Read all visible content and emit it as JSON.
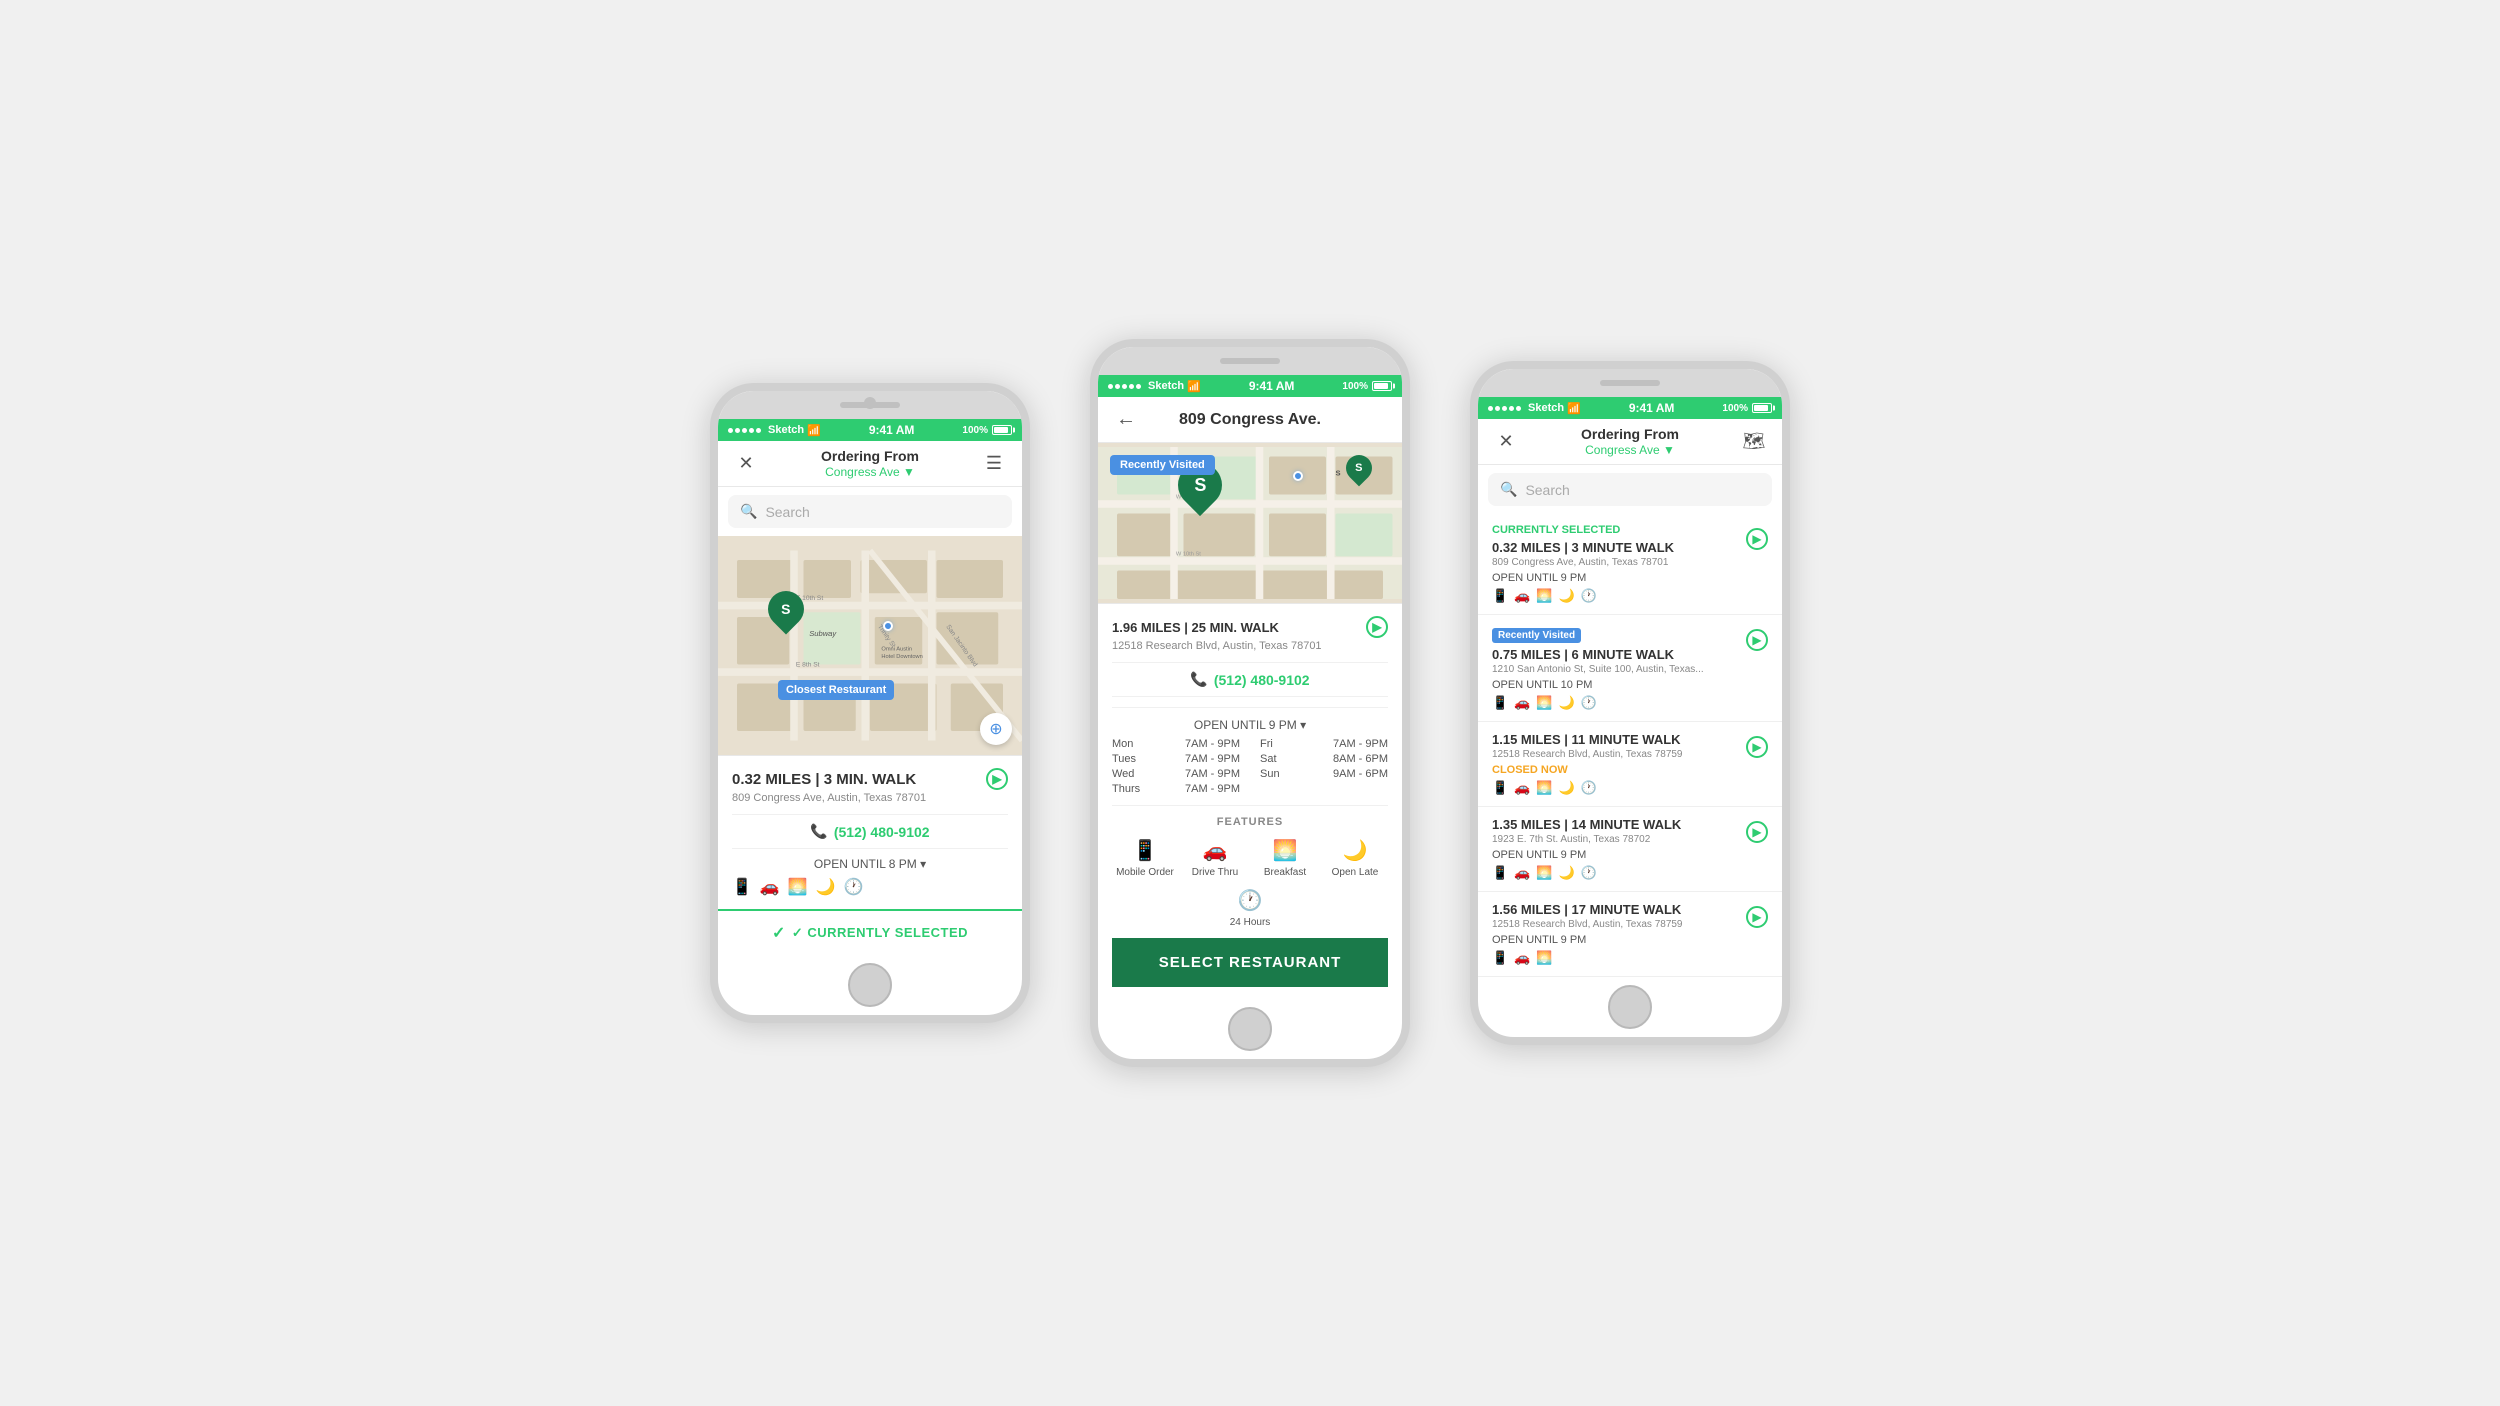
{
  "phone1": {
    "status": {
      "carrier": "Sketch",
      "time": "9:41 AM",
      "battery": "100%"
    },
    "nav": {
      "title": "Ordering From",
      "subtitle": "Congress Ave ▼",
      "left_icon": "✕",
      "right_icon": "☰"
    },
    "search": {
      "placeholder": "Search"
    },
    "map": {
      "closest_label": "Closest Restaurant"
    },
    "location": {
      "distance": "0.32 MILES | 3 MIN. WALK",
      "address": "809 Congress Ave, Austin, Texas 78701",
      "phone": "(512) 480-9102",
      "hours": "OPEN UNTIL 8 PM ▾"
    },
    "footer": {
      "label": "✓ CURRENTLY SELECTED"
    }
  },
  "phone2": {
    "status": {
      "carrier": "Sketch",
      "time": "9:41 AM",
      "battery": "100%"
    },
    "nav": {
      "title": "809 Congress Ave.",
      "left_icon": "←"
    },
    "badge": "Recently Visited",
    "location": {
      "distance": "1.96 MILES | 25 MIN. WALK",
      "address": "12518 Research Blvd, Austin, Texas 78701",
      "phone": "(512) 480-9102",
      "hours_label": "OPEN UNTIL 9 PM ▾"
    },
    "hours": {
      "mon": "7AM - 9PM",
      "tue": "7AM - 9PM",
      "wed": "7AM - 9PM",
      "thu": "7AM - 9PM",
      "fri": "7AM - 9PM",
      "sat": "8AM - 6PM",
      "sun": "9AM - 6PM"
    },
    "features": {
      "title": "FEATURES",
      "items": [
        {
          "icon": "📱",
          "label": "Mobile Order"
        },
        {
          "icon": "🚗",
          "label": "Drive Thru"
        },
        {
          "icon": "🌅",
          "label": "Breakfast"
        },
        {
          "icon": "🌙",
          "label": "Open Late"
        },
        {
          "icon": "🕐",
          "label": "24 Hours"
        }
      ]
    },
    "select_btn": "SELECT RESTAURANT"
  },
  "phone3": {
    "status": {
      "carrier": "Sketch",
      "time": "9:41 AM",
      "battery": "100%"
    },
    "nav": {
      "title": "Ordering From",
      "subtitle": "Congress Ave ▼",
      "left_icon": "✕",
      "right_icon": "🗺"
    },
    "search": {
      "placeholder": "Search"
    },
    "locations": [
      {
        "tag": "CURRENTLY SELECTED",
        "tag_color": "green",
        "distance": "0.32 MILES | 3 MINUTE WALK",
        "address": "809 Congress Ave, Austin, Texas 78701",
        "status": "OPEN UNTIL 9 PM",
        "has_badge": false
      },
      {
        "tag": "Recently Visited",
        "tag_color": "blue",
        "distance": "0.75 MILES | 6 MINUTE WALK",
        "address": "1210 San Antonio St, Suite 100, Austin, Texas...",
        "status": "OPEN UNTIL 10 PM",
        "has_badge": true
      },
      {
        "tag": "",
        "tag_color": "",
        "distance": "1.15 MILES | 11 MINUTE WALK",
        "address": "12518 Research Blvd, Austin, Texas 78759",
        "status": "CLOSED NOW",
        "status_color": "orange",
        "has_badge": false
      },
      {
        "tag": "",
        "tag_color": "",
        "distance": "1.35 MILES | 14 MINUTE WALK",
        "address": "1923 E. 7th St. Austin, Texas 78702",
        "status": "OPEN UNTIL 9 PM",
        "has_badge": false
      },
      {
        "tag": "",
        "tag_color": "",
        "distance": "1.56 MILES | 17 MINUTE WALK",
        "address": "12518 Research Blvd, Austin, Texas 78759",
        "status": "OPEN UNTIL 9 PM",
        "has_badge": false
      }
    ]
  }
}
